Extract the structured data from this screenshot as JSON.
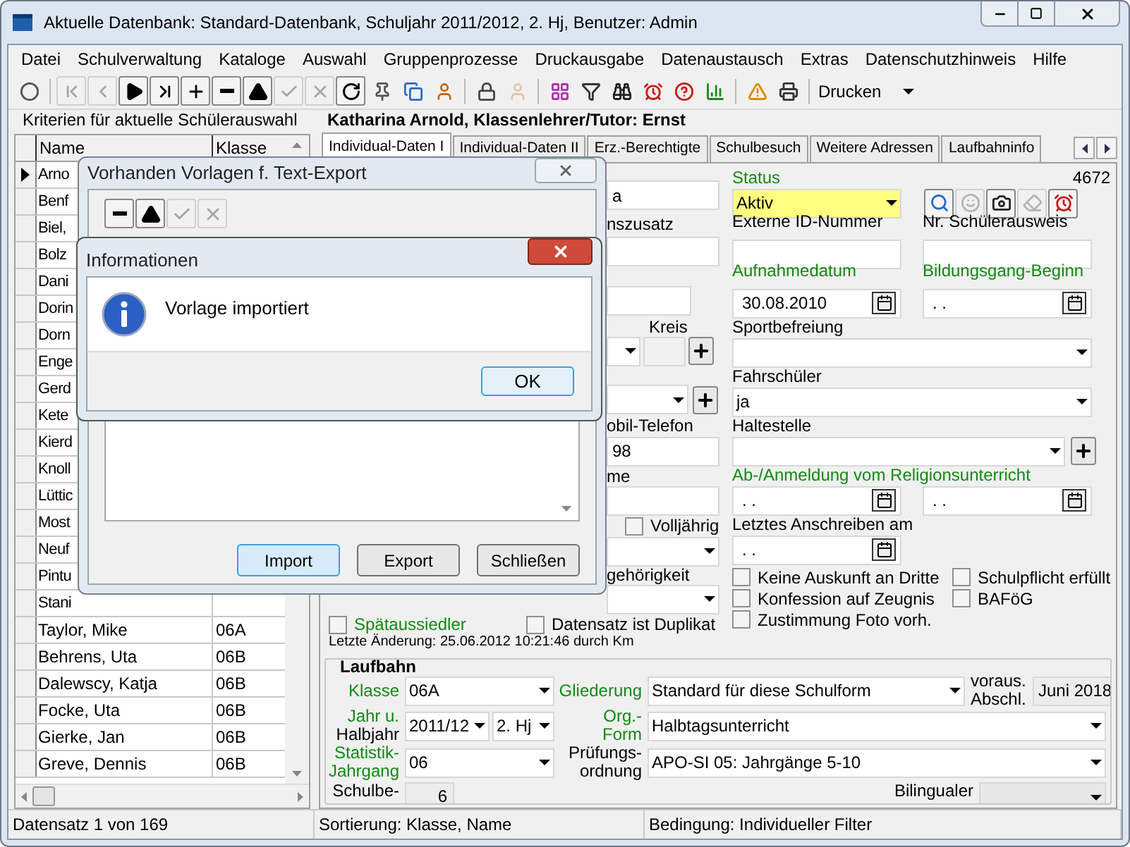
{
  "window": {
    "title": "Aktuelle Datenbank: Standard-Datenbank, Schuljahr 2011/2012, 2. Hj, Benutzer: Admin"
  },
  "menu": [
    "Datei",
    "Schulverwaltung",
    "Kataloge",
    "Auswahl",
    "Gruppenprozesse",
    "Druckausgabe",
    "Datenaustausch",
    "Extras",
    "Datenschutzhinweis",
    "Hilfe"
  ],
  "toolbar": {
    "tools": [
      {
        "kind": "circle",
        "disabled": false
      },
      {
        "kind": "first",
        "disabled": true
      },
      {
        "kind": "prev",
        "disabled": true
      },
      {
        "kind": "next",
        "disabled": false
      },
      {
        "kind": "last",
        "disabled": false
      },
      {
        "kind": "plus",
        "disabled": false
      },
      {
        "kind": "minus",
        "disabled": false
      },
      {
        "kind": "up",
        "disabled": false
      },
      {
        "kind": "check",
        "disabled": true
      },
      {
        "kind": "cross",
        "disabled": true
      },
      {
        "kind": "refresh",
        "disabled": false
      },
      {
        "kind": "pin",
        "disabled": false
      },
      {
        "kind": "copy",
        "disabled": false
      },
      {
        "kind": "user",
        "disabled": false
      },
      {
        "kind": "lock",
        "disabled": false
      },
      {
        "kind": "user",
        "disabled": true
      },
      {
        "kind": "grid",
        "disabled": false
      },
      {
        "kind": "filter",
        "disabled": false
      },
      {
        "kind": "binoculars",
        "disabled": false
      },
      {
        "kind": "alarm",
        "disabled": false
      },
      {
        "kind": "help",
        "disabled": false
      },
      {
        "kind": "chart",
        "disabled": false
      },
      {
        "kind": "warning",
        "disabled": false
      },
      {
        "kind": "printer",
        "disabled": false
      }
    ],
    "print_select": "Drucken"
  },
  "left_panel": {
    "title": "Kriterien für aktuelle Schülerauswahl",
    "columns": [
      "Name",
      "Klasse"
    ],
    "rows": [
      {
        "name": "Arno",
        "current": true
      },
      {
        "name": "Benf",
        "current": false
      },
      {
        "name": "Biel,",
        "current": false
      },
      {
        "name": "Bolz",
        "current": false
      },
      {
        "name": "Dani",
        "current": false
      },
      {
        "name": "Dorin",
        "current": false
      },
      {
        "name": "Dorn",
        "current": false
      },
      {
        "name": "Enge",
        "current": false
      },
      {
        "name": "Gerd",
        "current": false
      },
      {
        "name": "Kete",
        "current": false
      },
      {
        "name": "Kierd",
        "current": false
      },
      {
        "name": "Knoll",
        "current": false
      },
      {
        "name": "Lüttic",
        "current": false
      },
      {
        "name": "Most",
        "current": false
      },
      {
        "name": "Neuf",
        "current": false
      },
      {
        "name": "Pintu",
        "current": false
      },
      {
        "name": "Stani",
        "current": false
      },
      {
        "name": "Taylor, Mike",
        "klasse": "06A",
        "current": false
      },
      {
        "name": "Behrens, Uta",
        "klasse": "06B",
        "current": false
      },
      {
        "name": "Dalewscy, Katja",
        "klasse": "06B",
        "current": false
      },
      {
        "name": "Focke, Uta",
        "klasse": "06B",
        "current": false
      },
      {
        "name": "Gierke, Jan",
        "klasse": "06B",
        "current": false
      },
      {
        "name": "Greve, Dennis",
        "klasse": "06B",
        "current": false
      }
    ]
  },
  "student_header": "Katharina Arnold, Klassenlehrer/Tutor: Ernst",
  "tabs": [
    {
      "label": "Individual-Daten I",
      "selected": true
    },
    {
      "label": "Individual-Daten II",
      "selected": false
    },
    {
      "label": "Erz.-Berechtigte",
      "selected": false
    },
    {
      "label": "Schulbesuch",
      "selected": false
    },
    {
      "label": "Weitere Adressen",
      "selected": false
    },
    {
      "label": "Laufbahninfo",
      "selected": false
    }
  ],
  "form_left": {
    "field_1": "a",
    "label_2": "nszusatz",
    "label_kreis": "Kreis",
    "label_mobil": "obil-Telefon",
    "field_mobil": "98",
    "label_me": "me",
    "volljaehrig": {
      "label": "Volljährig",
      "checked": false
    },
    "label_gehoerigkeit": "gehörigkeit",
    "spaetaussiedler": {
      "label": {
        "text": "Spätaussiedler",
        "required": true
      },
      "checked": false
    },
    "duplikat": {
      "label": {
        "text": "Datensatz ist Duplikat",
        "required": false
      },
      "checked": false
    },
    "last_change": "Letzte Änderung: 25.06.2012 10:21:46 durch Km"
  },
  "form_right": {
    "status": {
      "label": {
        "text": "Status",
        "required": true
      },
      "value": "Aktiv"
    },
    "record_number": "4672",
    "tools": [
      {
        "kind": "search",
        "disabled": false
      },
      {
        "kind": "smile",
        "disabled": true
      },
      {
        "kind": "camera",
        "disabled": false
      },
      {
        "kind": "eraser",
        "disabled": true
      },
      {
        "kind": "alarm",
        "disabled": false
      }
    ],
    "externe_id": {
      "label": {
        "text": "Externe ID-Nummer",
        "required": false
      }
    },
    "ausweis": {
      "label": {
        "text": "Nr. Schülerausweis",
        "required": false
      }
    },
    "aufnahme": {
      "label": {
        "text": "Aufnahmedatum",
        "required": true
      },
      "value": "30.08.2010"
    },
    "bildungsgang": {
      "label": {
        "text": "Bildungsgang-Beginn",
        "required": true
      },
      "value": ". ."
    },
    "sport": {
      "label": {
        "text": "Sportbefreiung",
        "required": false
      }
    },
    "fahrschueler": {
      "label": {
        "text": "Fahrschüler",
        "required": false
      },
      "value": "ja"
    },
    "haltestelle": {
      "label": {
        "text": "Haltestelle",
        "required": false
      }
    },
    "religion": {
      "label": {
        "text": "Ab-/Anmeldung vom Religionsunterricht",
        "required": true
      },
      "abmeldung": ". .",
      "anmeldung": ". ."
    },
    "anschreiben": {
      "label": {
        "text": "Letztes Anschreiben am",
        "required": false
      },
      "value": ". ."
    },
    "flags": [
      {
        "label": "Keine Auskunft an Dritte",
        "checked": false
      },
      {
        "label": "Schulpflicht erfüllt",
        "checked": false
      },
      {
        "label": "Konfession auf Zeugnis",
        "checked": false
      },
      {
        "label": "BAFöG",
        "checked": false
      },
      {
        "label": "Zustimmung Foto vorh.",
        "checked": false
      }
    ]
  },
  "laufbahn": {
    "title": "Laufbahn",
    "klasse": {
      "label": [
        {
          "text": "Klasse",
          "required": true
        }
      ],
      "value": "06A"
    },
    "gliederung": {
      "label": [
        {
          "text": "Gliederung",
          "required": true
        }
      ],
      "value": "Standard für diese Schulform"
    },
    "abschluss": {
      "label": [
        {
          "text": "voraus.",
          "required": false
        },
        {
          "text": "Abschl.",
          "required": false
        }
      ],
      "value": "Juni 2018"
    },
    "jahr": {
      "label": [
        {
          "text": "Jahr u.",
          "required": true
        },
        {
          "text": "Halbjahr",
          "required": false
        }
      ],
      "year": "2011/12",
      "half": "2. Hj"
    },
    "org": {
      "label": [
        {
          "text": "Org.-",
          "required": true
        },
        {
          "text": "Form",
          "required": true
        }
      ],
      "value": "Halbtagsunterricht"
    },
    "statistik": {
      "label": [
        {
          "text": "Statistik-",
          "required": true
        },
        {
          "text": "Jahrgang",
          "required": true
        }
      ],
      "value": "06"
    },
    "pruefung": {
      "label": [
        {
          "text": "Prüfungs-",
          "required": false
        },
        {
          "text": "ordnung",
          "required": false
        }
      ],
      "value": "APO-SI 05: Jahrgänge 5-10"
    },
    "schulbesuch": {
      "label": [
        {
          "text": "Schulbe-",
          "required": false
        }
      ],
      "value": "6"
    },
    "bilingual": {
      "label": [
        {
          "text": "Bilingualer",
          "required": false
        }
      ]
    }
  },
  "status_bar": [
    "Datensatz 1 von 169",
    "Sortierung: Klasse, Name",
    "Bedingung: Individueller Filter"
  ],
  "export_dialog": {
    "title": "Vorhanden Vorlagen f. Text-Export",
    "tools": [
      {
        "kind": "minus",
        "disabled": false
      },
      {
        "kind": "up",
        "disabled": false
      },
      {
        "kind": "check",
        "disabled": true
      },
      {
        "kind": "cross",
        "disabled": true
      }
    ],
    "buttons": [
      {
        "label": "Import",
        "default": true
      },
      {
        "label": "Export",
        "default": false
      },
      {
        "label": "Schließen",
        "default": false
      }
    ]
  },
  "info_dialog": {
    "title": "Informationen",
    "message": "Vorlage importiert",
    "button": "OK"
  }
}
